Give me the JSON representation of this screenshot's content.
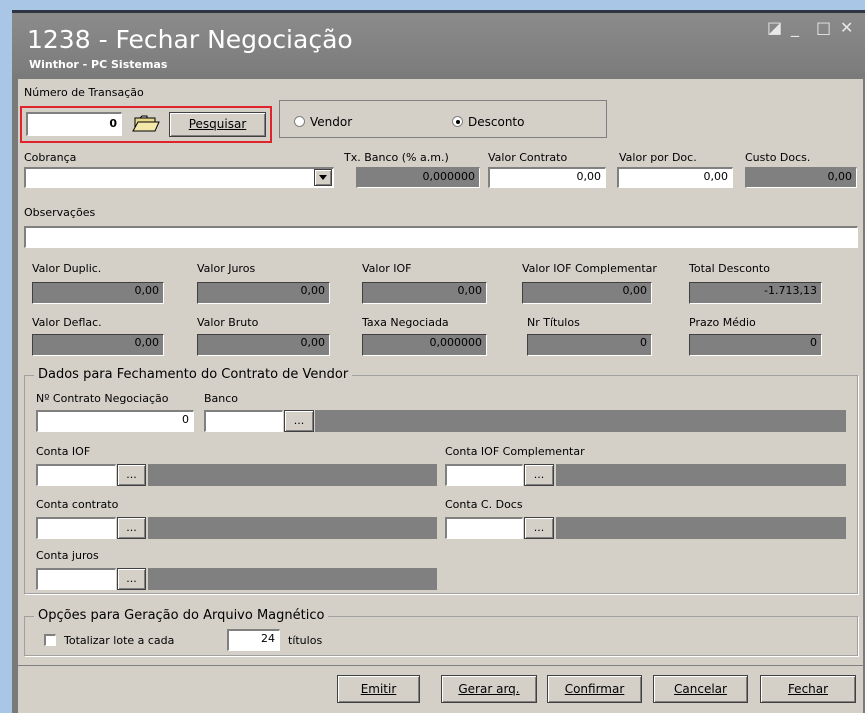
{
  "window": {
    "title": "1238 - Fechar Negociação",
    "subtitle": "Winthor - PC Sistemas",
    "controls": [
      "◪",
      "_",
      "□",
      "✕"
    ]
  },
  "transacao": {
    "label": "Número de Transação",
    "value": "0",
    "search_label": "Pesquisar"
  },
  "tipo": {
    "options": [
      "Vendor",
      "Desconto"
    ],
    "selected": "Desconto"
  },
  "cobranca": {
    "label": "Cobrança",
    "value": ""
  },
  "tx_banco": {
    "label": "Tx. Banco (% a.m.)",
    "value": "0,000000"
  },
  "valor_contrato": {
    "label": "Valor Contrato",
    "value": "0,00"
  },
  "valor_por_doc": {
    "label": "Valor por Doc.",
    "value": "0,00"
  },
  "custo_docs": {
    "label": "Custo Docs.",
    "value": "0,00"
  },
  "observacoes": {
    "label": "Observações",
    "value": ""
  },
  "totais": {
    "valor_duplic": {
      "label": "Valor Duplic.",
      "value": "0,00"
    },
    "valor_juros": {
      "label": "Valor Juros",
      "value": "0,00"
    },
    "valor_iof": {
      "label": "Valor IOF",
      "value": "0,00"
    },
    "valor_iof_comp": {
      "label": "Valor IOF Complementar",
      "value": "0,00"
    },
    "total_desconto": {
      "label": "Total Desconto",
      "value": "-1.713,13"
    },
    "valor_deflac": {
      "label": "Valor Deflac.",
      "value": "0,00"
    },
    "valor_bruto": {
      "label": "Valor Bruto",
      "value": "0,00"
    },
    "taxa_negociada": {
      "label": "Taxa Negociada",
      "value": "0,000000"
    },
    "nr_titulos": {
      "label": "Nr Títulos",
      "value": "0"
    },
    "prazo_medio": {
      "label": "Prazo Médio",
      "value": "0"
    }
  },
  "vendor": {
    "group_title": "Dados para Fechamento do Contrato de Vendor",
    "contrato_label": "Nº Contrato Negociação",
    "contrato_value": "0",
    "banco_label": "Banco",
    "conta_iof_label": "Conta IOF",
    "conta_iof_comp_label": "Conta IOF Complementar",
    "conta_contrato_label": "Conta contrato",
    "conta_cdocs_label": "Conta C. Docs",
    "conta_juros_label": "Conta juros",
    "ellipsis": "..."
  },
  "arquivo": {
    "group_title": "Opções para Geração do Arquivo Magnético",
    "totalizar_label": "Totalizar lote a cada",
    "totalizar_value": "24",
    "titulos_label": "títulos"
  },
  "buttons": {
    "emitir": "Emitir",
    "gerar_arq": "Gerar arq.",
    "confirmar": "Confirmar",
    "cancelar": "Cancelar",
    "fechar": "Fechar"
  },
  "colors": {
    "highlight_box": "#e0242c",
    "titlebar": "#7c7c7c",
    "form_bg": "#d4d0c8",
    "readonly_field": "#808080"
  }
}
